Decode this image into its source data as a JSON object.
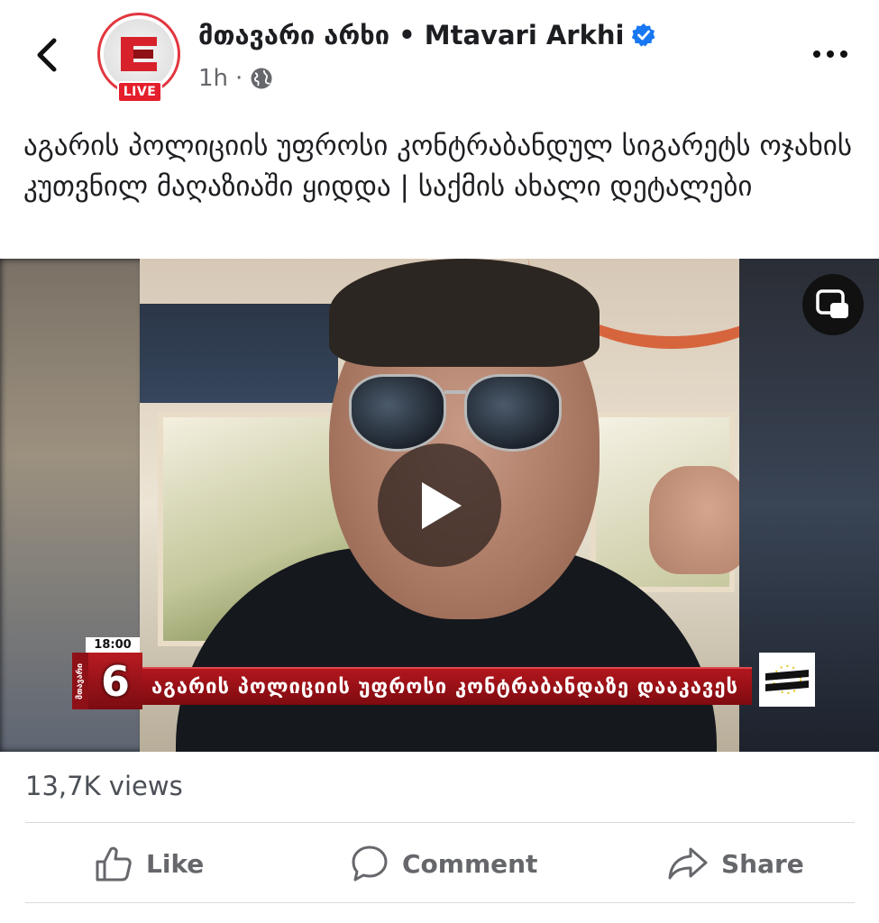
{
  "post": {
    "page_name": "მთავარი არხი • Mtavari Arkhi",
    "time": "1h",
    "separator": "·",
    "live_label": "LIVE",
    "caption": "აგარის პოლიციის უფროსი კონტრაბანდულ სიგარეტს ოჯახის კუთვნილ მაღაზიაში ყიდდა | საქმის ახალი დეტალები",
    "verified_icon": "verified-badge-icon",
    "audience_icon": "globe-icon"
  },
  "video": {
    "ticker_time": "18:00",
    "ticker_channel_number": "6",
    "ticker_channel_vertical": "მთავარი",
    "ticker_headline": "აგარის პოლიციის უფროსი კონტრაბანდაზე დააკავეს",
    "play_icon": "play-icon",
    "pip_icon": "picture-in-picture-icon"
  },
  "stats": {
    "views": "13,7K views"
  },
  "actions": {
    "like": "Like",
    "comment": "Comment",
    "share": "Share"
  },
  "colors": {
    "brand_red": "#e41e2b",
    "verified_blue": "#1877f2",
    "text_secondary": "#65676b"
  }
}
